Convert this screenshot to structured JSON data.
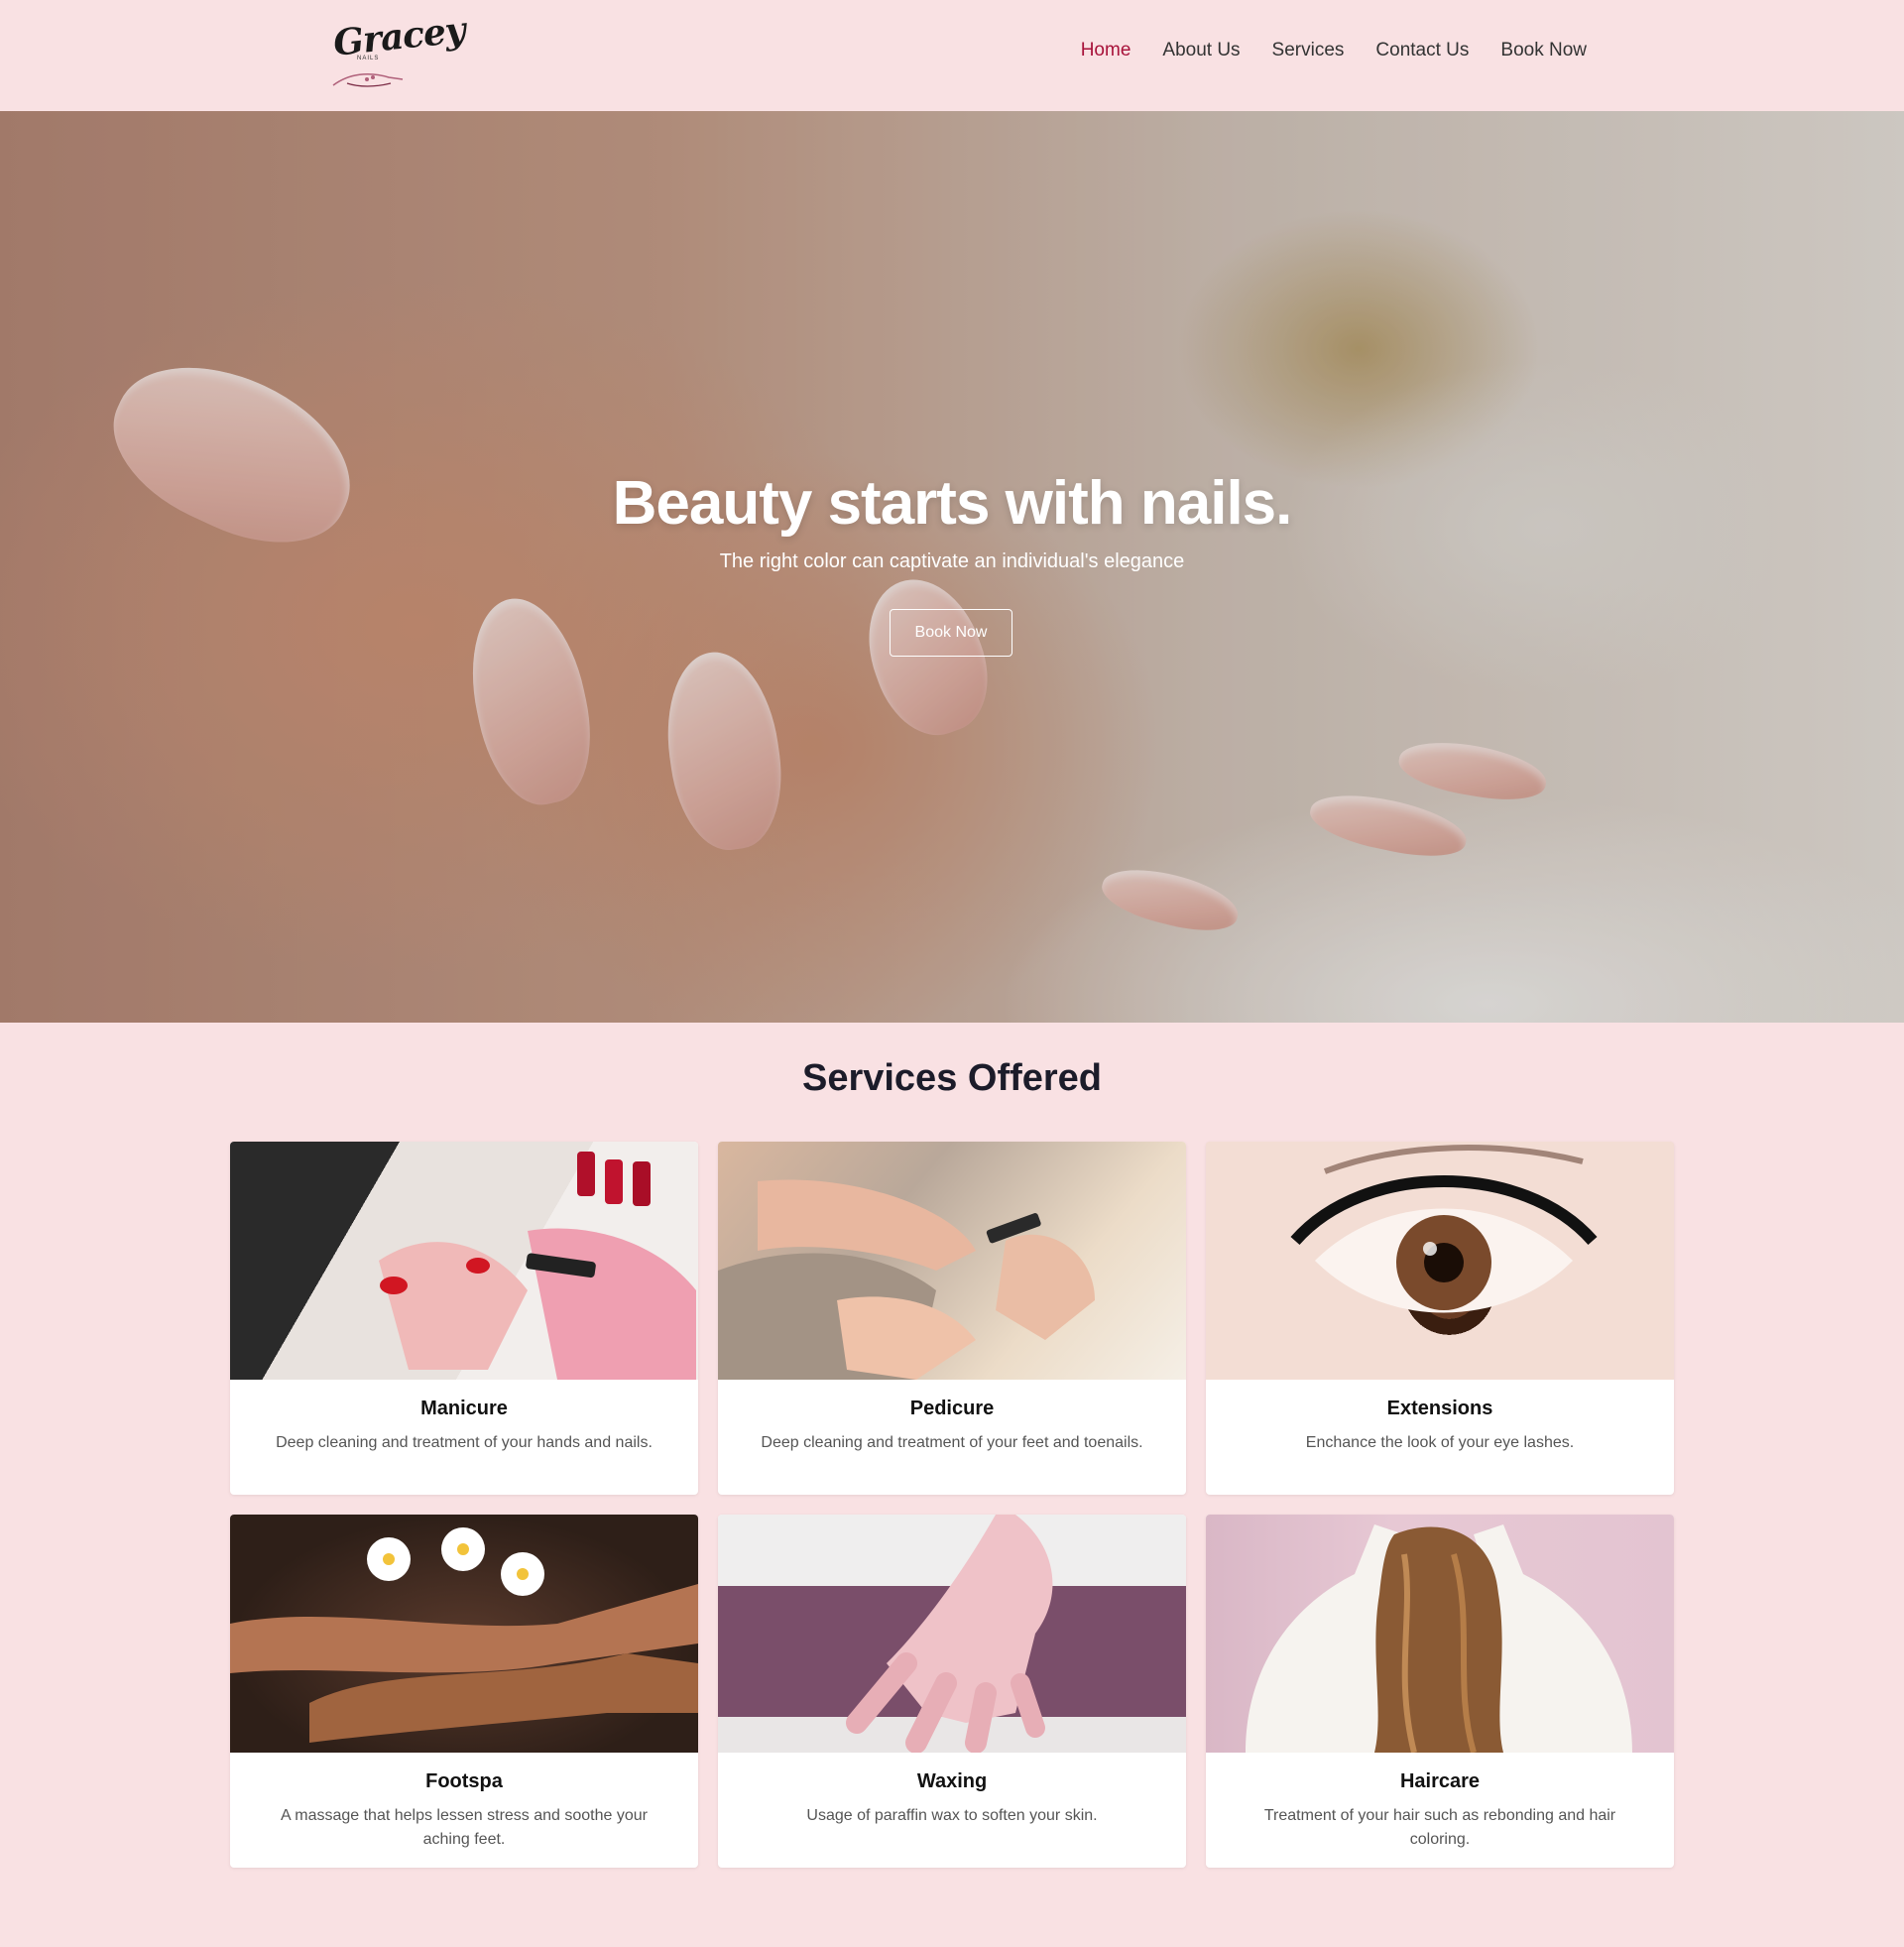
{
  "brand": {
    "logo_text": "Gracey",
    "logo_sub": "NAILS"
  },
  "nav": {
    "items": [
      {
        "label": "Home",
        "active": true
      },
      {
        "label": "About Us",
        "active": false
      },
      {
        "label": "Services",
        "active": false
      },
      {
        "label": "Contact Us",
        "active": false
      },
      {
        "label": "Book Now",
        "active": false
      }
    ]
  },
  "hero": {
    "title": "Beauty starts with nails.",
    "subtitle": "The right color can captivate an individual's elegance",
    "button_label": "Book Now"
  },
  "services": {
    "heading": "Services Offered",
    "cards": [
      {
        "title": "Manicure",
        "description": "Deep cleaning and treatment of your hands and nails."
      },
      {
        "title": "Pedicure",
        "description": "Deep cleaning and treatment of your feet and toenails."
      },
      {
        "title": "Extensions",
        "description": "Enchance the look of your eye lashes."
      },
      {
        "title": "Footspa",
        "description": "A massage that helps lessen stress and soothe your aching feet."
      },
      {
        "title": "Waxing",
        "description": "Usage of paraffin wax to soften your skin."
      },
      {
        "title": "Haircare",
        "description": "Treatment of your hair such as rebonding and hair coloring."
      }
    ]
  },
  "colors": {
    "background": "#f9e1e3",
    "accent": "#a8123a",
    "heading": "#1c1c2a"
  }
}
